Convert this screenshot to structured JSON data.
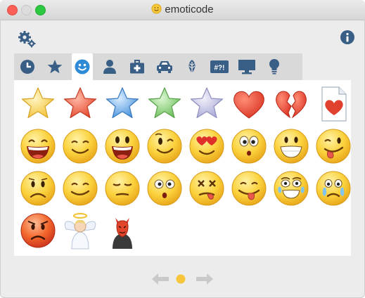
{
  "window": {
    "title": "emoticode"
  },
  "toolbar": {
    "settings_icon": "gear-icon",
    "info_icon": "info-icon"
  },
  "tabs": [
    {
      "name": "recent",
      "icon": "clock-icon"
    },
    {
      "name": "favorites",
      "icon": "star-icon"
    },
    {
      "name": "smileys",
      "icon": "smiley-icon",
      "active": true
    },
    {
      "name": "people",
      "icon": "person-icon"
    },
    {
      "name": "objects",
      "icon": "medkit-icon"
    },
    {
      "name": "travel",
      "icon": "car-icon"
    },
    {
      "name": "nature",
      "icon": "leaf-icon"
    },
    {
      "name": "symbols",
      "icon": "symbols-icon",
      "label": "#?!"
    },
    {
      "name": "computer",
      "icon": "monitor-icon"
    },
    {
      "name": "ideas",
      "icon": "lightbulb-icon"
    }
  ],
  "colors": {
    "accent": "#2f8bd6",
    "tab_icon": "#3a5f86",
    "star_yellow": "#f7cf4a",
    "star_red": "#ef5b42",
    "star_blue": "#5aa3e6",
    "star_green": "#79c76a",
    "star_lavender": "#b9b9e0",
    "heart": "#e0402e",
    "face": "#f8c93a"
  },
  "emoticons": [
    "yellow-star",
    "red-star",
    "blue-star",
    "green-star",
    "lavender-star",
    "red-heart",
    "broken-heart",
    "heart-document",
    "laughing-face",
    "smiling-face",
    "big-grin-face",
    "winking-face",
    "heart-eyes-face",
    "surprised-face",
    "grimacing-face",
    "tongue-out-face",
    "sad-face",
    "smirk-face",
    "sleepy-face",
    "shocked-face",
    "dizzy-face",
    "tongue-wink-face",
    "tearful-laugh-face",
    "crying-face",
    "angry-red-face",
    "angel-icon",
    "devil-icon"
  ],
  "pager": {
    "current_page": 1,
    "total_pages": 1
  }
}
